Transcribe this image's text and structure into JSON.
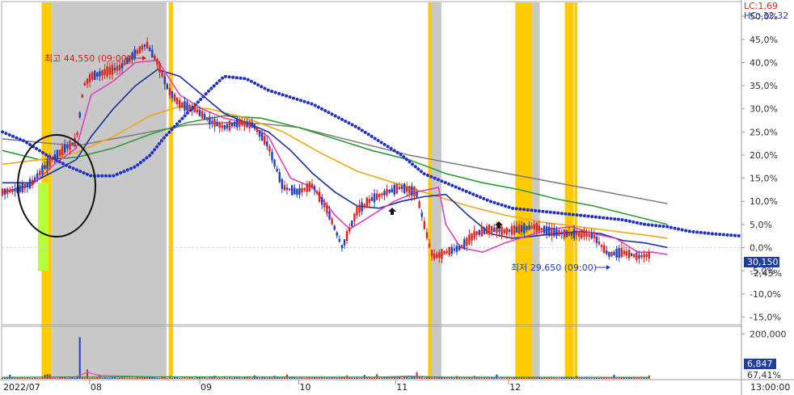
{
  "chart_data": {
    "type": "candlestick",
    "price_axis": {
      "unit": "%",
      "ticks": [
        "50,0%",
        "45,0%",
        "40,0%",
        "35,0%",
        "30,0%",
        "25,0%",
        "20,0%",
        "15,0%",
        "10,0%",
        "5,0%",
        "0,0%",
        "-5,0%",
        "-10,0%",
        "-15,0%"
      ],
      "ylim": [
        -16.5,
        53
      ]
    },
    "volume_axis": {
      "ticks": [
        "200,000"
      ],
      "ylim": [
        0,
        230000
      ]
    },
    "x_axis": {
      "ticks": [
        {
          "label": "2022/07",
          "pos": 0.0
        },
        {
          "label": "08",
          "pos": 0.118
        },
        {
          "label": "09",
          "pos": 0.267
        },
        {
          "label": "10",
          "pos": 0.401
        },
        {
          "label": "11",
          "pos": 0.532
        },
        {
          "label": "12",
          "pos": 0.685
        },
        {
          "label": "13:00:00",
          "pos": 1.0
        }
      ]
    },
    "header": {
      "lc": "LC:1,69",
      "hc": "HC:-32,32"
    },
    "annotations": {
      "high": {
        "label": "최고 44,550 (09:00)",
        "value": 44.5
      },
      "low": {
        "label": "최저 29,650 (09:00)",
        "value": -2.6
      }
    },
    "tags": {
      "price": {
        "label": "30,150",
        "sub": "-2,45%",
        "value": -2.45,
        "color": "#1f3f9a"
      },
      "volume": {
        "label": "6,847",
        "sub": "67,41%",
        "value": 6847,
        "color": "#1f3f9a"
      }
    },
    "highlights": [
      {
        "from": 0.053,
        "to": 0.067,
        "kind": "yellow"
      },
      {
        "from": 0.067,
        "to": 0.222,
        "kind": "gray"
      },
      {
        "from": 0.225,
        "to": 0.231,
        "kind": "yellow"
      },
      {
        "from": 0.576,
        "to": 0.581,
        "kind": "yellow"
      },
      {
        "from": 0.581,
        "to": 0.594,
        "kind": "gray"
      },
      {
        "from": 0.694,
        "to": 0.698,
        "kind": "yellow"
      },
      {
        "from": 0.698,
        "to": 0.717,
        "kind": "yellow"
      },
      {
        "from": 0.717,
        "to": 0.727,
        "kind": "gray"
      },
      {
        "from": 0.761,
        "to": 0.773,
        "kind": "yellow"
      },
      {
        "from": 0.774,
        "to": 0.778,
        "kind": "yellow"
      }
    ],
    "series": [
      {
        "kind": "price",
        "color": "#e0241b",
        "x": [
          0.0,
          0.02,
          0.04,
          0.055,
          0.07,
          0.085,
          0.1,
          0.11,
          0.12,
          0.14,
          0.16,
          0.18,
          0.195,
          0.21,
          0.225,
          0.24,
          0.26,
          0.28,
          0.3,
          0.32,
          0.34,
          0.36,
          0.38,
          0.4,
          0.42,
          0.44,
          0.46,
          0.48,
          0.5,
          0.52,
          0.54,
          0.56,
          0.58,
          0.585,
          0.6,
          0.62,
          0.64,
          0.66,
          0.68,
          0.7,
          0.72,
          0.74,
          0.76,
          0.78,
          0.8,
          0.82,
          0.84,
          0.86,
          0.88,
          0.9
        ],
        "y": [
          12.0,
          12.5,
          14.0,
          17.0,
          19.5,
          21.5,
          23.0,
          35.0,
          37.0,
          38.0,
          39.0,
          42.0,
          44.0,
          40.0,
          34.0,
          31.0,
          30.0,
          27.5,
          26.0,
          27.0,
          26.5,
          22.0,
          13.0,
          12.0,
          13.5,
          8.0,
          0.0,
          8.0,
          10.5,
          12.0,
          13.0,
          12.0,
          -1.0,
          -2.0,
          -1.0,
          0.0,
          3.0,
          4.0,
          3.5,
          4.0,
          4.5,
          3.5,
          3.0,
          3.0,
          2.5,
          -1.5,
          -1.0,
          -2.0,
          -1.5,
          -2.45
        ]
      },
      {
        "kind": "ma_short",
        "color": "#e040c0",
        "x": [
          0.0,
          0.04,
          0.07,
          0.1,
          0.12,
          0.15,
          0.18,
          0.21,
          0.24,
          0.27,
          0.3,
          0.33,
          0.36,
          0.39,
          0.42,
          0.45,
          0.47,
          0.5,
          0.53,
          0.56,
          0.59,
          0.6,
          0.62,
          0.65,
          0.68,
          0.71,
          0.74,
          0.77,
          0.8,
          0.83,
          0.86,
          0.88,
          0.9
        ],
        "y": [
          12.0,
          13.5,
          18.0,
          21.5,
          33.0,
          36.0,
          40.0,
          40.5,
          33.0,
          30.0,
          28.0,
          27.0,
          24.0,
          15.0,
          13.0,
          7.0,
          4.0,
          7.0,
          10.0,
          12.0,
          13.0,
          5.0,
          0.0,
          -1.0,
          1.0,
          2.5,
          4.0,
          4.5,
          3.0,
          2.0,
          -1.0,
          -1.0,
          -1.5
        ]
      },
      {
        "kind": "ma_mid",
        "color": "#1a2f9c",
        "x": [
          0.0,
          0.04,
          0.07,
          0.1,
          0.12,
          0.15,
          0.18,
          0.21,
          0.24,
          0.27,
          0.3,
          0.33,
          0.36,
          0.39,
          0.42,
          0.45,
          0.48,
          0.51,
          0.54,
          0.57,
          0.6,
          0.63,
          0.66,
          0.69,
          0.72,
          0.75,
          0.78,
          0.81,
          0.84,
          0.87,
          0.9
        ],
        "y": [
          14.0,
          14.0,
          16.5,
          19.0,
          24.0,
          30.0,
          35.0,
          38.5,
          37.0,
          33.0,
          29.0,
          27.0,
          25.0,
          21.0,
          16.0,
          12.0,
          9.0,
          8.5,
          10.0,
          11.0,
          11.5,
          7.0,
          3.0,
          2.0,
          2.5,
          3.0,
          3.5,
          3.0,
          1.5,
          1.0,
          0.0
        ]
      },
      {
        "kind": "ma_long",
        "color": "#f0a818",
        "x": [
          0.0,
          0.05,
          0.1,
          0.15,
          0.2,
          0.24,
          0.28,
          0.33,
          0.38,
          0.43,
          0.48,
          0.53,
          0.58,
          0.63,
          0.68,
          0.73,
          0.78,
          0.83,
          0.88,
          0.9
        ],
        "y": [
          18.0,
          19.0,
          20.5,
          24.0,
          28.5,
          30.5,
          30.0,
          28.0,
          25.0,
          20.5,
          16.5,
          14.0,
          11.5,
          9.0,
          7.0,
          5.5,
          4.5,
          3.5,
          2.5,
          2.0
        ]
      },
      {
        "kind": "ma_verylong",
        "color": "#2e9a38",
        "x": [
          0.0,
          0.05,
          0.1,
          0.15,
          0.2,
          0.25,
          0.3,
          0.35,
          0.4,
          0.45,
          0.5,
          0.55,
          0.6,
          0.65,
          0.7,
          0.75,
          0.8,
          0.85,
          0.9
        ],
        "y": [
          21.0,
          19.0,
          19.5,
          21.5,
          24.5,
          27.0,
          28.5,
          28.0,
          26.0,
          23.5,
          21.0,
          19.0,
          16.0,
          14.0,
          12.5,
          10.5,
          9.0,
          7.0,
          5.0
        ]
      },
      {
        "kind": "ma_gray",
        "color": "#808080",
        "x": [
          0.0,
          0.1,
          0.2,
          0.25,
          0.3,
          0.35,
          0.4,
          0.45,
          0.5,
          0.55,
          0.6,
          0.65,
          0.7,
          0.75,
          0.8,
          0.85,
          0.9
        ],
        "y": [
          23.5,
          22.0,
          25.0,
          26.5,
          27.0,
          26.8,
          26.0,
          24.0,
          22.0,
          20.0,
          18.5,
          17.0,
          15.5,
          14.0,
          12.5,
          11.0,
          9.5
        ]
      },
      {
        "kind": "ma_dotted",
        "color": "#1f2fc8",
        "x": [
          0.0,
          0.03,
          0.06,
          0.09,
          0.12,
          0.15,
          0.18,
          0.2,
          0.22,
          0.25,
          0.28,
          0.3,
          0.33,
          0.36,
          0.39,
          0.42,
          0.45,
          0.48,
          0.51,
          0.54,
          0.57,
          0.6,
          0.63,
          0.66,
          0.69,
          0.72,
          0.75,
          0.78,
          0.81,
          0.84,
          0.87,
          0.9,
          0.93,
          0.96,
          1.0
        ],
        "y": [
          25.0,
          23.0,
          20.0,
          17.5,
          15.5,
          15.5,
          17.5,
          20.0,
          24.0,
          29.0,
          34.0,
          37.0,
          36.5,
          34.0,
          32.5,
          31.0,
          28.5,
          26.0,
          23.0,
          20.0,
          16.0,
          14.0,
          12.0,
          10.0,
          8.5,
          8.0,
          7.5,
          7.0,
          6.5,
          6.0,
          5.0,
          4.5,
          3.5,
          3.0,
          2.5
        ]
      }
    ]
  }
}
